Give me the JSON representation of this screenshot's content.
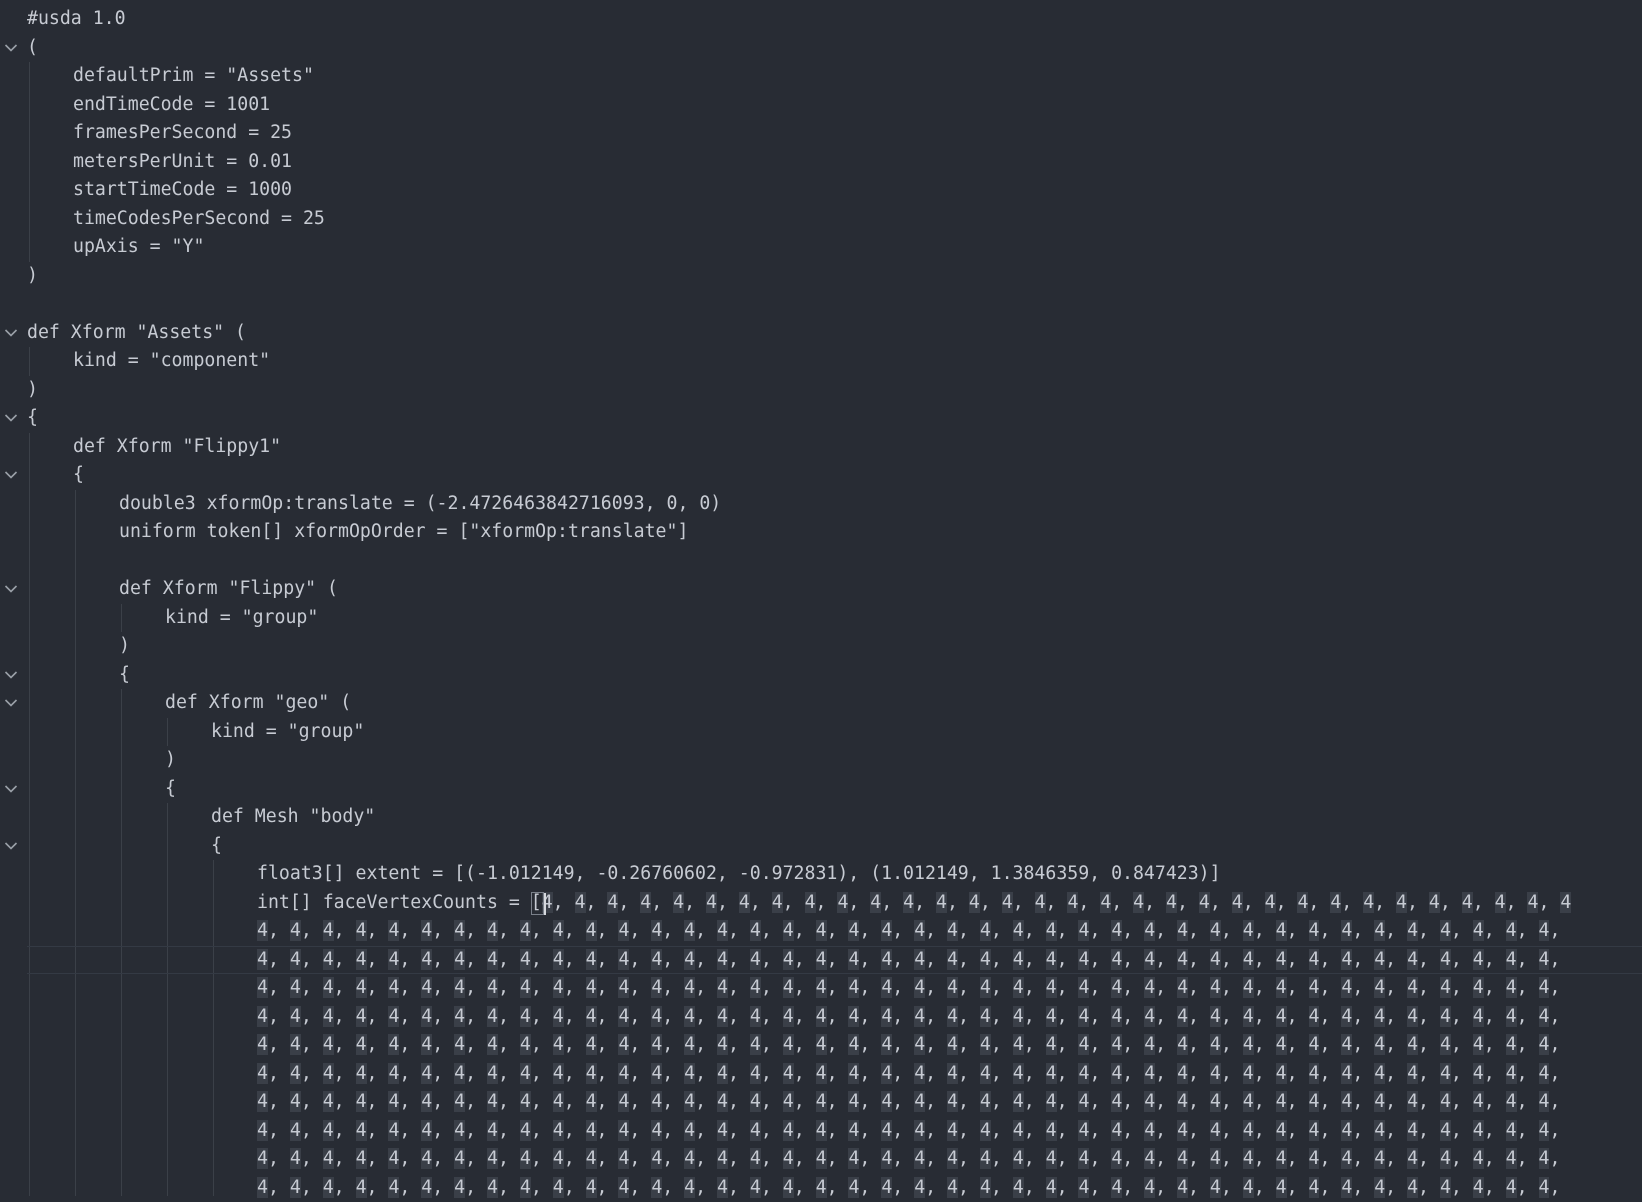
{
  "colors": {
    "background": "#282c34",
    "text": "#c7cbd3",
    "fold_icon": "#9aa0a8",
    "indent_guide": "#3b4048",
    "match_highlight": "#3a3f48"
  },
  "top_partial": "' ' ' '  ' ' '' '  ' '   '  '  ' '  '",
  "lines": [
    {
      "fold": false,
      "indent": 0,
      "text": "#usda 1.0"
    },
    {
      "fold": true,
      "indent": 0,
      "text": "("
    },
    {
      "fold": false,
      "indent": 1,
      "text": "defaultPrim = \"Assets\""
    },
    {
      "fold": false,
      "indent": 1,
      "text": "endTimeCode = 1001"
    },
    {
      "fold": false,
      "indent": 1,
      "text": "framesPerSecond = 25"
    },
    {
      "fold": false,
      "indent": 1,
      "text": "metersPerUnit = 0.01"
    },
    {
      "fold": false,
      "indent": 1,
      "text": "startTimeCode = 1000"
    },
    {
      "fold": false,
      "indent": 1,
      "text": "timeCodesPerSecond = 25"
    },
    {
      "fold": false,
      "indent": 1,
      "text": "upAxis = \"Y\""
    },
    {
      "fold": false,
      "indent": 0,
      "text": ")"
    },
    {
      "fold": false,
      "indent": 0,
      "text": ""
    },
    {
      "fold": true,
      "indent": 0,
      "text": "def Xform \"Assets\" ("
    },
    {
      "fold": false,
      "indent": 1,
      "text": "kind = \"component\""
    },
    {
      "fold": false,
      "indent": 0,
      "text": ")"
    },
    {
      "fold": true,
      "indent": 0,
      "text": "{"
    },
    {
      "fold": false,
      "indent": 1,
      "text": "def Xform \"Flippy1\""
    },
    {
      "fold": true,
      "indent": 1,
      "text": "{"
    },
    {
      "fold": false,
      "indent": 2,
      "text": "double3 xformOp:translate = (-2.4726463842716093, 0, 0)"
    },
    {
      "fold": false,
      "indent": 2,
      "text": "uniform token[] xformOpOrder = [\"xformOp:translate\"]"
    },
    {
      "fold": false,
      "indent": 2,
      "text": ""
    },
    {
      "fold": true,
      "indent": 2,
      "text": "def Xform \"Flippy\" ("
    },
    {
      "fold": false,
      "indent": 3,
      "text": "kind = \"group\""
    },
    {
      "fold": false,
      "indent": 2,
      "text": ")"
    },
    {
      "fold": true,
      "indent": 2,
      "text": "{"
    },
    {
      "fold": true,
      "indent": 3,
      "text": "def Xform \"geo\" ("
    },
    {
      "fold": false,
      "indent": 4,
      "text": "kind = \"group\""
    },
    {
      "fold": false,
      "indent": 3,
      "text": ")"
    },
    {
      "fold": true,
      "indent": 3,
      "text": "{"
    },
    {
      "fold": false,
      "indent": 4,
      "text": "def Mesh \"body\""
    },
    {
      "fold": true,
      "indent": 4,
      "text": "{"
    },
    {
      "fold": false,
      "indent": 5,
      "text": "float3[] extent = [(-1.012149, -0.26760602, -0.972831), (1.012149, 1.3846359, 0.847423)]"
    },
    {
      "fold": false,
      "indent": 5,
      "text": "int[] faceVertexCounts = [4, 4, 4, 4, 4, 4, 4, 4, 4, 4, 4, 4, 4, 4, 4, 4, 4, 4, 4, 4, 4, 4, 4, 4, 4, 4, 4, 4, 4, 4, 4, 4"
    },
    {
      "fold": false,
      "indent": 5,
      "text": "4, 4, 4, 4, 4, 4, 4, 4, 4, 4, 4, 4, 4, 4, 4, 4, 4, 4, 4, 4, 4, 4, 4, 4, 4, 4, 4, 4, 4, 4, 4, 4, 4, 4, 4, 4, 4, 4, 4, 4,"
    },
    {
      "fold": false,
      "indent": 5,
      "text": "4, 4, 4, 4, 4, 4, 4, 4, 4, 4, 4, 4, 4, 4, 4, 4, 4, 4, 4, 4, 4, 4, 4, 4, 4, 4, 4, 4, 4, 4, 4, 4, 4, 4, 4, 4, 4, 4, 4, 4,"
    },
    {
      "fold": false,
      "indent": 5,
      "text": "4, 4, 4, 4, 4, 4, 4, 4, 4, 4, 4, 4, 4, 4, 4, 4, 4, 4, 4, 4, 4, 4, 4, 4, 4, 4, 4, 4, 4, 4, 4, 4, 4, 4, 4, 4, 4, 4, 4, 4,"
    },
    {
      "fold": false,
      "indent": 5,
      "text": "4, 4, 4, 4, 4, 4, 4, 4, 4, 4, 4, 4, 4, 4, 4, 4, 4, 4, 4, 4, 4, 4, 4, 4, 4, 4, 4, 4, 4, 4, 4, 4, 4, 4, 4, 4, 4, 4, 4, 4,"
    },
    {
      "fold": false,
      "indent": 5,
      "text": "4, 4, 4, 4, 4, 4, 4, 4, 4, 4, 4, 4, 4, 4, 4, 4, 4, 4, 4, 4, 4, 4, 4, 4, 4, 4, 4, 4, 4, 4, 4, 4, 4, 4, 4, 4, 4, 4, 4, 4,"
    },
    {
      "fold": false,
      "indent": 5,
      "text": "4, 4, 4, 4, 4, 4, 4, 4, 4, 4, 4, 4, 4, 4, 4, 4, 4, 4, 4, 4, 4, 4, 4, 4, 4, 4, 4, 4, 4, 4, 4, 4, 4, 4, 4, 4, 4, 4, 4, 4,"
    },
    {
      "fold": false,
      "indent": 5,
      "text": "4, 4, 4, 4, 4, 4, 4, 4, 4, 4, 4, 4, 4, 4, 4, 4, 4, 4, 4, 4, 4, 4, 4, 4, 4, 4, 4, 4, 4, 4, 4, 4, 4, 4, 4, 4, 4, 4, 4, 4,"
    },
    {
      "fold": false,
      "indent": 5,
      "text": "4, 4, 4, 4, 4, 4, 4, 4, 4, 4, 4, 4, 4, 4, 4, 4, 4, 4, 4, 4, 4, 4, 4, 4, 4, 4, 4, 4, 4, 4, 4, 4, 4, 4, 4, 4, 4, 4, 4, 4,"
    },
    {
      "fold": false,
      "indent": 5,
      "text": "4, 4, 4, 4, 4, 4, 4, 4, 4, 4, 4, 4, 4, 4, 4, 4, 4, 4, 4, 4, 4, 4, 4, 4, 4, 4, 4, 4, 4, 4, 4, 4, 4, 4, 4, 4, 4, 4, 4, 4,"
    },
    {
      "fold": false,
      "indent": 5,
      "text": "4, 4, 4, 4, 4, 4, 4, 4, 4, 4, 4, 4, 4, 4, 4, 4, 4, 4, 4, 4, 4, 4, 4, 4, 4, 4, 4, 4, 4, 4, 4, 4, 4, 4, 4, 4, 4, 4, 4, 4,"
    }
  ]
}
